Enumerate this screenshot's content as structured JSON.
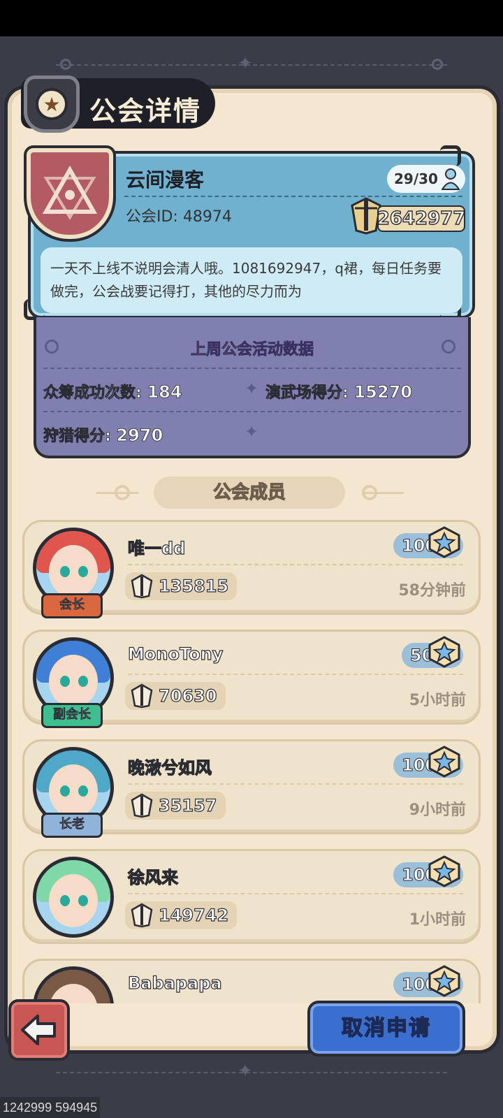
{
  "page_title": "公会详情",
  "guild": {
    "name": "云间漫客",
    "id_text": "公会ID: 48974",
    "member_count": "29/30",
    "power": "2642977",
    "description": "一天不上线不说明会清人哦。1081692947，q裙，每日任务要做完，公会战要记得打，其他的尽力而为"
  },
  "stats": {
    "title": "上周公会活动数据",
    "crowdfund_label": "众筹成功次数:",
    "crowdfund_value": "184",
    "arena_label": "演武场得分:",
    "arena_value": "15270",
    "hunt_label": "狩猎得分:",
    "hunt_value": "2970"
  },
  "members_header": "公会成员",
  "members": [
    {
      "name": "唯一dd",
      "level": "100",
      "power": "135815",
      "last_seen": "58分钟前",
      "role": "会长",
      "role_color": "#d9673f",
      "hair_color": "#e0564f"
    },
    {
      "name": "MonoTony",
      "level": "50",
      "power": "70630",
      "last_seen": "5小时前",
      "role": "副会长",
      "role_color": "#3fbf8f",
      "hair_color": "#3f7fd8"
    },
    {
      "name": "晚湫兮如风",
      "level": "100",
      "power": "35157",
      "last_seen": "9小时前",
      "role": "长老",
      "role_color": "#8fb3d9",
      "hair_color": "#4fa8c8"
    },
    {
      "name": "徐风来",
      "level": "100",
      "power": "149742",
      "last_seen": "1小时前",
      "role": "",
      "role_color": "",
      "hair_color": "#7fd8a8"
    },
    {
      "name": "Babapapa",
      "level": "100",
      "power": "",
      "last_seen": "",
      "role": "",
      "role_color": "",
      "hair_color": "#7a5a46"
    }
  ],
  "cancel_button": "取消申请",
  "bottom_coords": "1242999 594945",
  "colors": {
    "panel_bg": "#f4e6cf",
    "guild_card": "#6fb1cf",
    "stats_bg": "#7f80b0",
    "cancel_button": "#3b6fcf",
    "back_button": "#c85652"
  }
}
